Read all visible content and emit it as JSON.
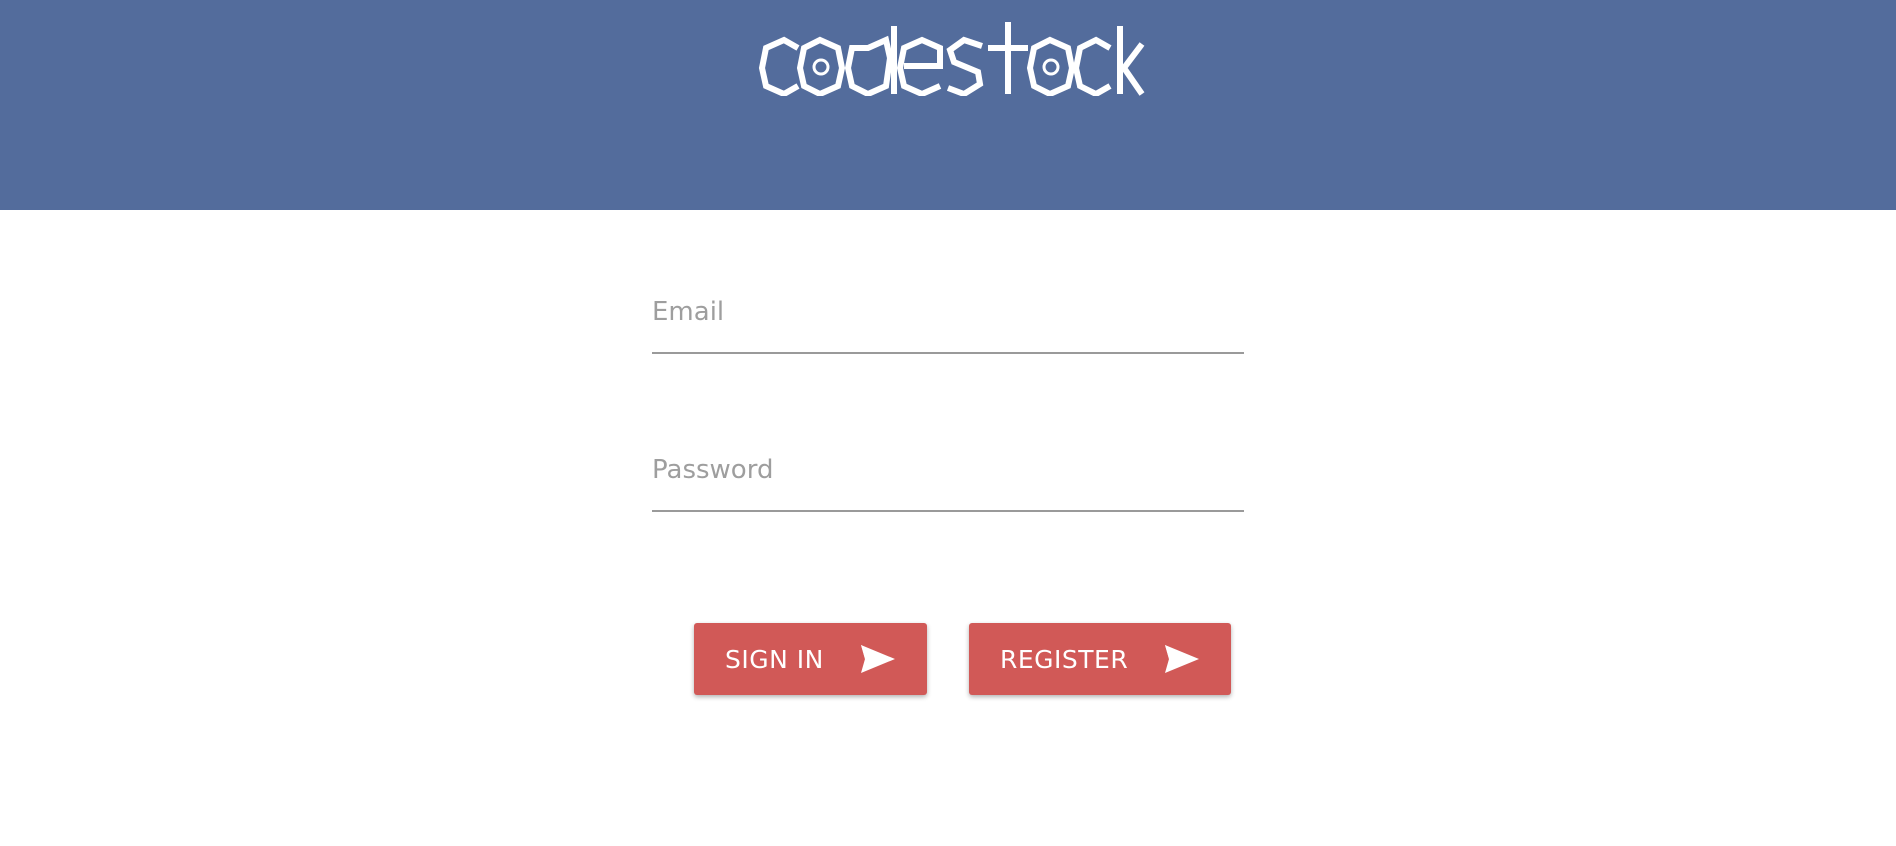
{
  "header": {
    "logo_text": "codestock",
    "background_color": "#536c9c",
    "logo_color": "#ffffff"
  },
  "form": {
    "email": {
      "placeholder": "Email",
      "value": ""
    },
    "password": {
      "placeholder": "Password",
      "value": ""
    }
  },
  "buttons": {
    "sign_in": {
      "label": "SIGN IN",
      "icon": "send-icon"
    },
    "register": {
      "label": "REGISTER",
      "icon": "send-icon"
    },
    "color": "#d15957"
  }
}
